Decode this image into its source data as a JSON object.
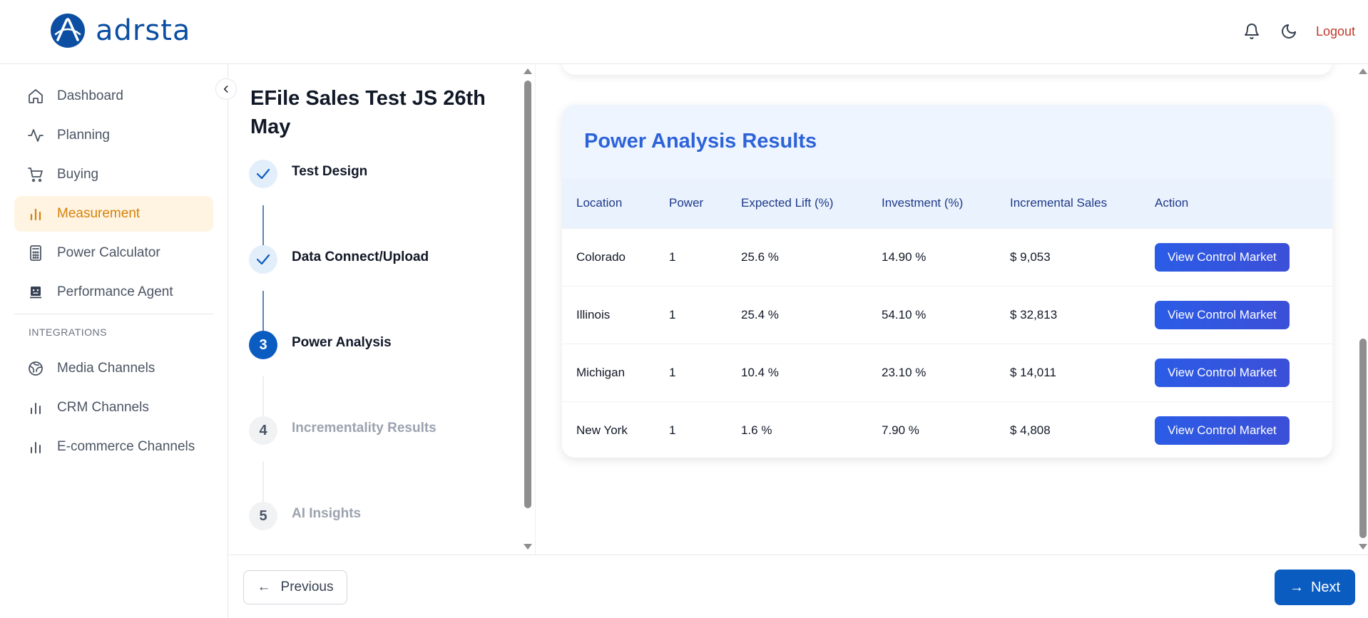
{
  "header": {
    "logo_text": "adrsta",
    "logout_label": "Logout",
    "brand_color": "#0b4ea2"
  },
  "sidebar": {
    "items": [
      {
        "label": "Dashboard",
        "icon": "home-icon"
      },
      {
        "label": "Planning",
        "icon": "activity-icon"
      },
      {
        "label": "Buying",
        "icon": "cart-icon"
      },
      {
        "label": "Measurement",
        "icon": "bar-chart-icon",
        "active": true
      },
      {
        "label": "Power Calculator",
        "icon": "calculator-icon"
      },
      {
        "label": "Performance Agent",
        "icon": "bot-icon"
      }
    ],
    "section_label": "INTEGRATIONS",
    "integrations": [
      {
        "label": "Media Channels",
        "icon": "globe-icon"
      },
      {
        "label": "CRM Channels",
        "icon": "bar-chart-icon"
      },
      {
        "label": "E-commerce Channels",
        "icon": "bar-chart-icon"
      }
    ],
    "active_color": "#d4820a"
  },
  "steps_panel": {
    "title": "EFile Sales Test JS 26th May",
    "steps": [
      {
        "number": "1",
        "label": "Test Design",
        "state": "done"
      },
      {
        "number": "2",
        "label": "Data Connect/Upload",
        "state": "done"
      },
      {
        "number": "3",
        "label": "Power Analysis",
        "state": "current"
      },
      {
        "number": "4",
        "label": "Incrementality Results",
        "state": "pending"
      },
      {
        "number": "5",
        "label": "AI Insights",
        "state": "pending"
      }
    ]
  },
  "results": {
    "title": "Power Analysis Results",
    "columns": [
      "Location",
      "Power",
      "Expected Lift (%)",
      "Investment (%)",
      "Incremental Sales",
      "Action"
    ],
    "rows": [
      {
        "location": "Colorado",
        "power": "1",
        "lift": "25.6 %",
        "investment": "14.90 %",
        "sales": "$ 9,053",
        "action": "View Control Market"
      },
      {
        "location": "Illinois",
        "power": "1",
        "lift": "25.4 %",
        "investment": "54.10 %",
        "sales": "$ 32,813",
        "action": "View Control Market"
      },
      {
        "location": "Michigan",
        "power": "1",
        "lift": "10.4 %",
        "investment": "23.10 %",
        "sales": "$ 14,011",
        "action": "View Control Market"
      },
      {
        "location": "New York",
        "power": "1",
        "lift": "1.6 %",
        "investment": "7.90 %",
        "sales": "$ 4,808",
        "action": "View Control Market"
      }
    ]
  },
  "footer": {
    "previous_arrow": "←",
    "previous_label": "Previous",
    "next_arrow": "→",
    "next_label": "Next"
  }
}
